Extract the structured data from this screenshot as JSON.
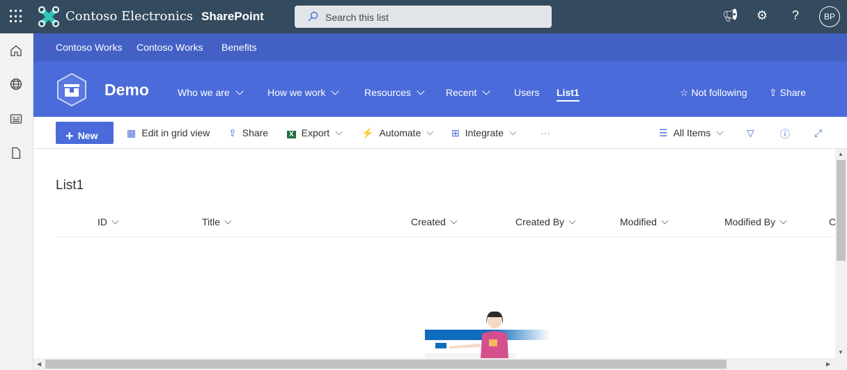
{
  "topbar": {
    "brand": "Contoso Electronics",
    "app": "SharePoint",
    "search_placeholder": "Search this list",
    "avatar": "BP"
  },
  "hub": {
    "links": [
      "Contoso Works",
      "Contoso Works",
      "Benefits"
    ]
  },
  "site": {
    "title": "Demo",
    "nav": [
      "Who we are",
      "How we work",
      "Resources",
      "Recent",
      "Users",
      "List1"
    ],
    "follow": "Not following",
    "share": "Share"
  },
  "commandbar": {
    "new": "New",
    "edit_grid": "Edit in grid view",
    "share": "Share",
    "export": "Export",
    "automate": "Automate",
    "integrate": "Integrate",
    "more": "···",
    "view": "All Items"
  },
  "list": {
    "title": "List1",
    "columns": [
      "ID",
      "Title",
      "Created",
      "Created By",
      "Modified",
      "Modified By",
      "C"
    ]
  },
  "colors": {
    "topbar": "#344a5e",
    "hub": "#4360c4",
    "site": "#4a6bd9"
  }
}
